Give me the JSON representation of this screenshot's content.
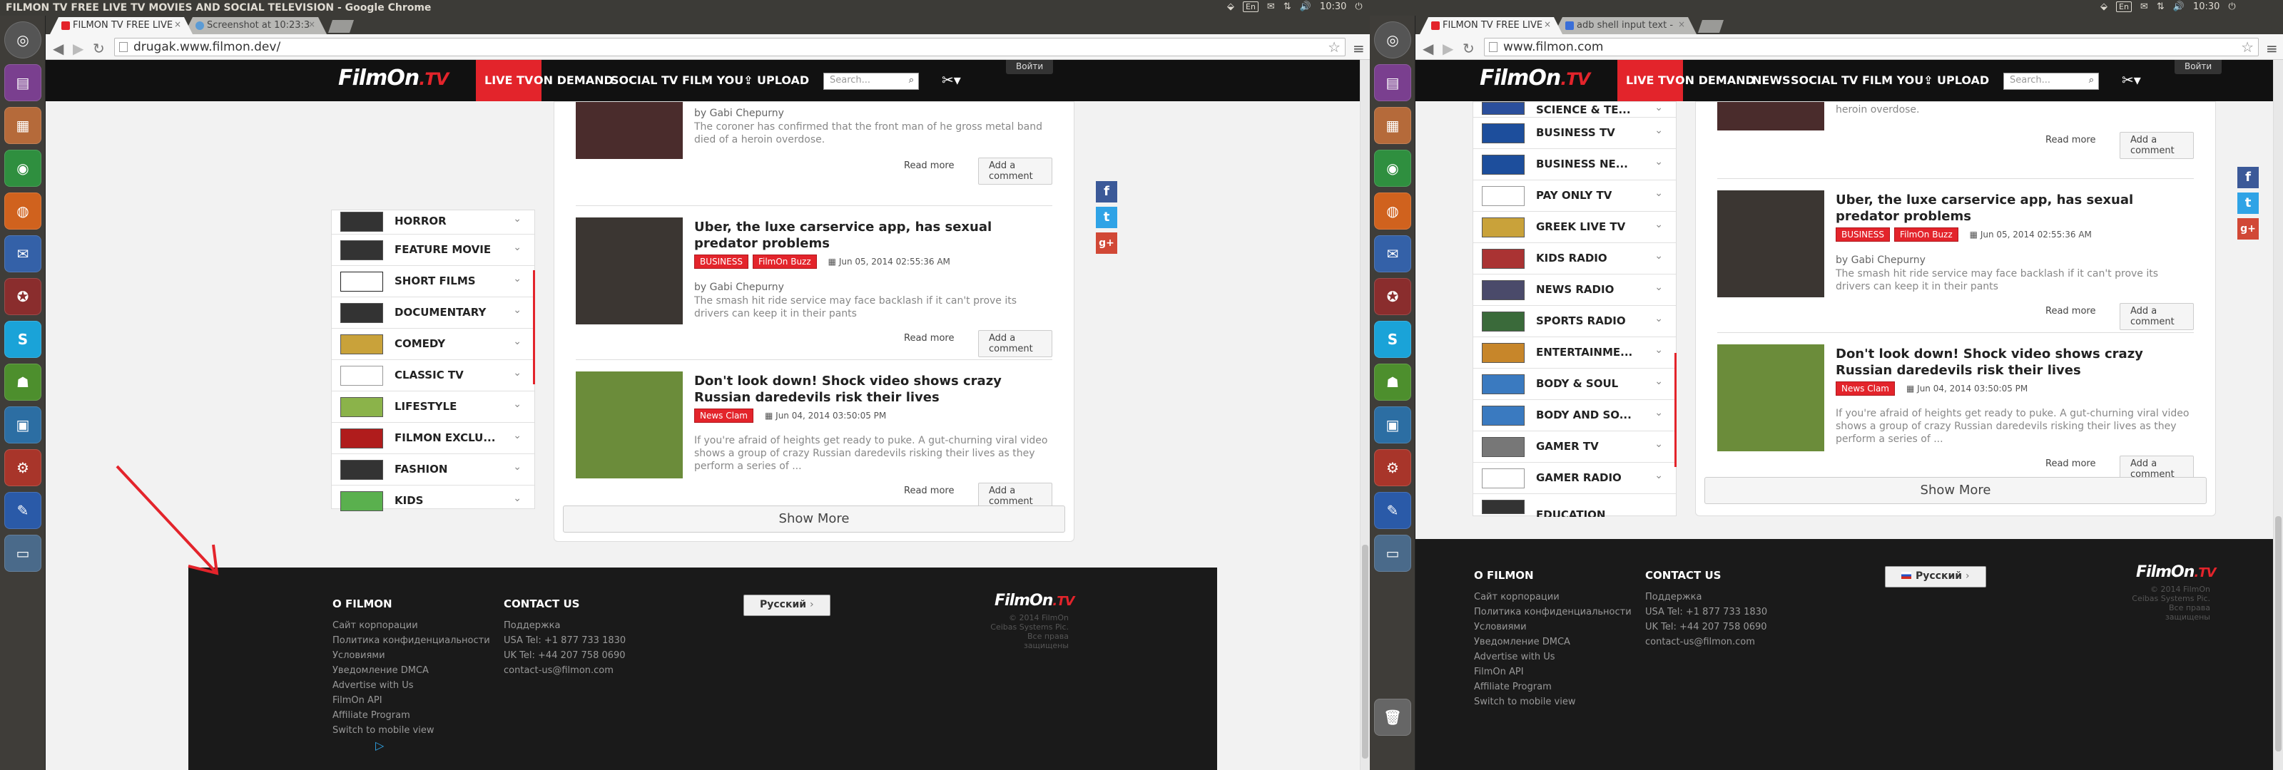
{
  "system": {
    "title": "FILMON TV FREE LIVE TV MOVIES AND SOCIAL TELEVISION - Google Chrome",
    "keyboard": "En",
    "time": "10:30"
  },
  "left": {
    "tabs": [
      {
        "label": "FILMON TV FREE LIVE"
      },
      {
        "label": "Screenshot at 10:23:3"
      }
    ],
    "url": "drugak.www.filmon.dev/",
    "nav": [
      "LIVE TV",
      "ON DEMAND",
      "SOCIAL TV",
      "FILM YOU",
      "UPLOAD"
    ],
    "search_placeholder": "Search...",
    "login": "Войти",
    "channels": [
      "HORROR",
      "FEATURE MOVIE",
      "SHORT FILMS",
      "DOCUMENTARY",
      "COMEDY",
      "CLASSIC TV",
      "LIFESTYLE",
      "FILMON EXCLU...",
      "FASHION",
      "KIDS"
    ],
    "articles": [
      {
        "title": "",
        "tags": [],
        "date": "",
        "by": "by Gabi Chepurny",
        "excerpt": "The coroner has confirmed that the front man of he gross metal band died of a heroin overdose."
      },
      {
        "title": "Uber, the luxe carservice app, has sexual predator problems",
        "tags": [
          "BUSINESS",
          "FilmOn Buzz"
        ],
        "date": "Jun 05, 2014 02:55:36 AM",
        "by": "by Gabi Chepurny",
        "excerpt": "The smash hit ride service may face backlash if it can't prove its drivers can keep it in their pants"
      },
      {
        "title": "Don't look down! Shock video shows crazy Russian daredevils risk their lives",
        "tags": [
          "News Clam"
        ],
        "date": "Jun 04, 2014 03:50:05 PM",
        "by": "",
        "excerpt": "If you're afraid of heights get ready to puke. A gut-churning viral video shows a group of crazy Russian daredevils risking their lives as they perform a series of ..."
      }
    ]
  },
  "right": {
    "tabs": [
      {
        "label": "FILMON TV FREE LIVE"
      },
      {
        "label": "adb shell input text - "
      }
    ],
    "url": "www.filmon.com",
    "nav": [
      "LIVE TV",
      "ON DEMAND",
      "NEWS",
      "SOCIAL TV",
      "FILM YOU",
      "UPLOAD"
    ],
    "search_placeholder": "Search...",
    "login": "Войти",
    "channels": [
      "SCIENCE & TE...",
      "BUSINESS TV",
      "BUSINESS NE...",
      "PAY ONLY TV",
      "GREEK LIVE TV",
      "KIDS RADIO",
      "NEWS RADIO",
      "SPORTS RADIO",
      "ENTERTAINME...",
      "BODY & SOUL",
      "BODY AND SO...",
      "GAMER TV",
      "GAMER RADIO",
      "EDUCATION"
    ],
    "articles": [
      {
        "title": "",
        "tags": [],
        "date": "",
        "by": "",
        "excerpt": "heroin overdose."
      },
      {
        "title": "Uber, the luxe carservice app, has sexual predator problems",
        "tags": [
          "BUSINESS",
          "FilmOn Buzz"
        ],
        "date": "Jun 05, 2014 02:55:36 AM",
        "by": "by Gabi Chepurny",
        "excerpt": "The smash hit ride service may face backlash if it can't prove its drivers can keep it in their pants"
      },
      {
        "title": "Don't look down! Shock video shows crazy Russian daredevils risk their lives",
        "tags": [
          "News Clam"
        ],
        "date": "Jun 04, 2014 03:50:05 PM",
        "by": "",
        "excerpt": "If you're afraid of heights get ready to puke. A gut-churning viral video shows a group of crazy Russian daredevils risking their lives as they perform a series of ..."
      }
    ]
  },
  "common": {
    "read_more": "Read more",
    "add_comment": "Add a comment",
    "show_more": "Show More",
    "logo": "FilmOn",
    "logo_tv": ".TV",
    "footer": {
      "about_h": "О FILMON",
      "about": [
        "Сайт корпорации",
        "Политика конфиденциальности",
        "Условиями",
        "Уведомление DMCA",
        "Advertise with Us",
        "FilmOn API",
        "Affiliate Program",
        "Switch to mobile view"
      ],
      "contact_h": "CONTACT US",
      "contact": [
        "Поддержка",
        "USA Tel: +1 877 733 1830",
        "UK Tel: +44 207 758 0690",
        "contact-us@filmon.com"
      ],
      "language": "Русский",
      "copyright": [
        "© 2014 FilmOn",
        "Ceibas Systems Pic.",
        "Все права защищены"
      ]
    }
  },
  "colors": {
    "brand_red": "#e3242b",
    "header_bg": "#111111",
    "facebook": "#3b5998",
    "twitter": "#2fa3e6",
    "googleplus": "#d14836"
  },
  "launcher_icons": [
    "ubuntu-dash-icon",
    "files-icon",
    "store-icon",
    "chrome-icon",
    "firefox-icon",
    "thunderbird-icon",
    "app-icon",
    "skype-icon",
    "android-icon",
    "document-icon",
    "settings-icon",
    "tool-icon",
    "monitor-icon",
    "trash-icon"
  ]
}
